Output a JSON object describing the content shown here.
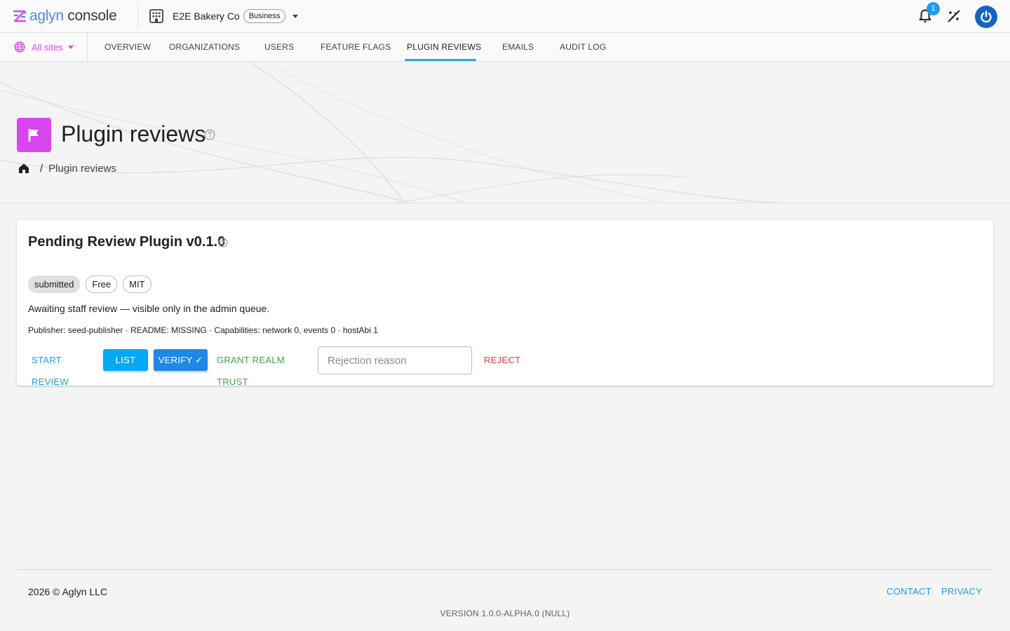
{
  "app": {
    "logo_brand": "aglyn",
    "logo_suffix": "console"
  },
  "org": {
    "name": "E2E Bakery Co",
    "plan": "Business"
  },
  "notifications": {
    "count": "1"
  },
  "nav": {
    "sites_label": "All sites",
    "tabs": [
      {
        "label": "OVERVIEW"
      },
      {
        "label": "ORGANIZATIONS"
      },
      {
        "label": "USERS"
      },
      {
        "label": "FEATURE FLAGS"
      },
      {
        "label": "PLUGIN REVIEWS",
        "active": true
      },
      {
        "label": "EMAILS"
      },
      {
        "label": "AUDIT LOG"
      }
    ]
  },
  "page": {
    "title": "Plugin reviews",
    "breadcrumb_current": "Plugin reviews"
  },
  "card": {
    "title": "Pending Review Plugin v0.1.0",
    "chips": [
      "submitted",
      "Free",
      "MIT"
    ],
    "description": "Awaiting staff review — visible only in the admin queue.",
    "meta": "Publisher: seed-publisher · README: MISSING · Capabilities: network 0, events 0 · hostAbi 1",
    "actions": {
      "start_review": "START REVIEW",
      "list": "LIST",
      "verify": "VERIFY ✓",
      "grant_trust": "GRANT REALM TRUST",
      "rejection_placeholder": "Rejection reason",
      "reject": "REJECT"
    }
  },
  "footer": {
    "copyright": "2026 © Aglyn LLC",
    "contact": "CONTACT",
    "privacy": "PRIVACY",
    "version": "VERSION 1.0.0-ALPHA.0 (NULL)"
  },
  "colors": {
    "accent_magenta": "#d946ef",
    "accent_blue": "#1e9bf0",
    "verify_blue": "#1e88e5",
    "list_blue": "#03a9f4",
    "success_green": "#43a047",
    "danger_red": "#e53935",
    "power_blue": "#1565c0"
  },
  "icons": {
    "logo": "aglyn-logo-icon",
    "org": "building-icon",
    "notifications": "bell-icon",
    "theme": "magic-wand-icon",
    "account": "power-icon",
    "sites": "globe-icon",
    "page": "flag-icon",
    "help": "help-circle-icon",
    "home": "home-icon"
  }
}
